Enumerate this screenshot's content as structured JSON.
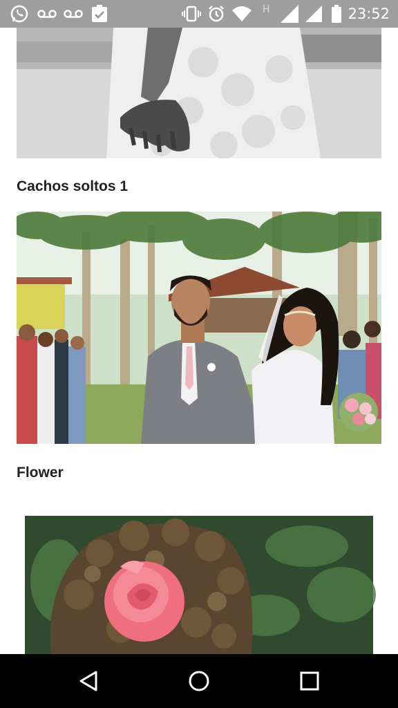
{
  "status_bar": {
    "time": "23:52",
    "icons_left": [
      "whatsapp-icon",
      "voicemail-icon",
      "voicemail-icon",
      "clipboard-check-icon"
    ],
    "icons_right": [
      "vibrate-icon",
      "alarm-icon",
      "wifi-icon",
      "h-network-icon",
      "signal-icon",
      "signal-icon",
      "battery-icon"
    ],
    "network_type": "H"
  },
  "gallery": {
    "items": [
      {
        "caption": "",
        "image": "bride-dress-black-white-photo"
      },
      {
        "caption": "Cachos soltos 1",
        "image": "wedding-couple-walking-aisle-photo"
      },
      {
        "caption": "Flower",
        "image": "curly-hair-pink-rose-photo"
      }
    ]
  },
  "nav_bar": {
    "buttons": [
      "back-icon",
      "home-icon",
      "recents-icon"
    ]
  }
}
